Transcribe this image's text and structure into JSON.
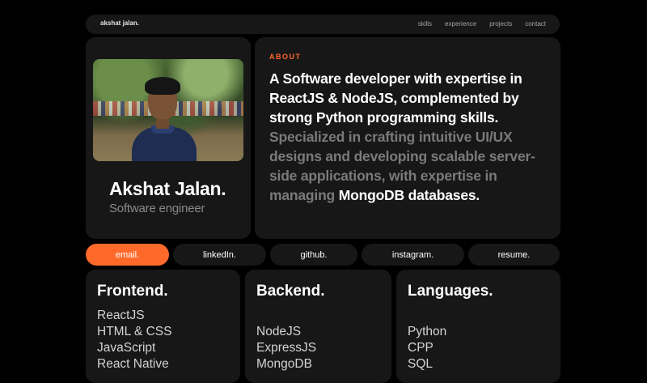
{
  "nav": {
    "logo": "akshat jalan.",
    "links": [
      "skills",
      "experience",
      "projects",
      "contact"
    ]
  },
  "profile": {
    "photo_alt": "Profile photo",
    "name": "Akshat Jalan.",
    "role": "Software engineer"
  },
  "about": {
    "label": "ABOUT",
    "lead": "A Software developer with expertise in ReactJS & NodeJS, complemented by strong Python programming skills.",
    "detail": " Specialized in crafting intuitive UI/UX designs and developing scalable server-side applications, with expertise in managing ",
    "highlight": "MongoDB databases."
  },
  "socials": [
    "email.",
    "linkedIn.",
    "github.",
    "instagram.",
    "resume."
  ],
  "skills": {
    "frontend": {
      "title": "Frontend.",
      "items": [
        "ReactJS",
        "HTML & CSS",
        "JavaScript",
        "React Native"
      ]
    },
    "backend": {
      "title": "Backend.",
      "items": [
        "NodeJS",
        "ExpressJS",
        "MongoDB"
      ]
    },
    "languages": {
      "title": "Languages.",
      "items": [
        "Python",
        "CPP",
        "SQL"
      ]
    }
  },
  "colors": {
    "accent": "#ff6a2b",
    "card": "#171717",
    "background": "#000000",
    "muted_text": "#7a7a7a"
  }
}
